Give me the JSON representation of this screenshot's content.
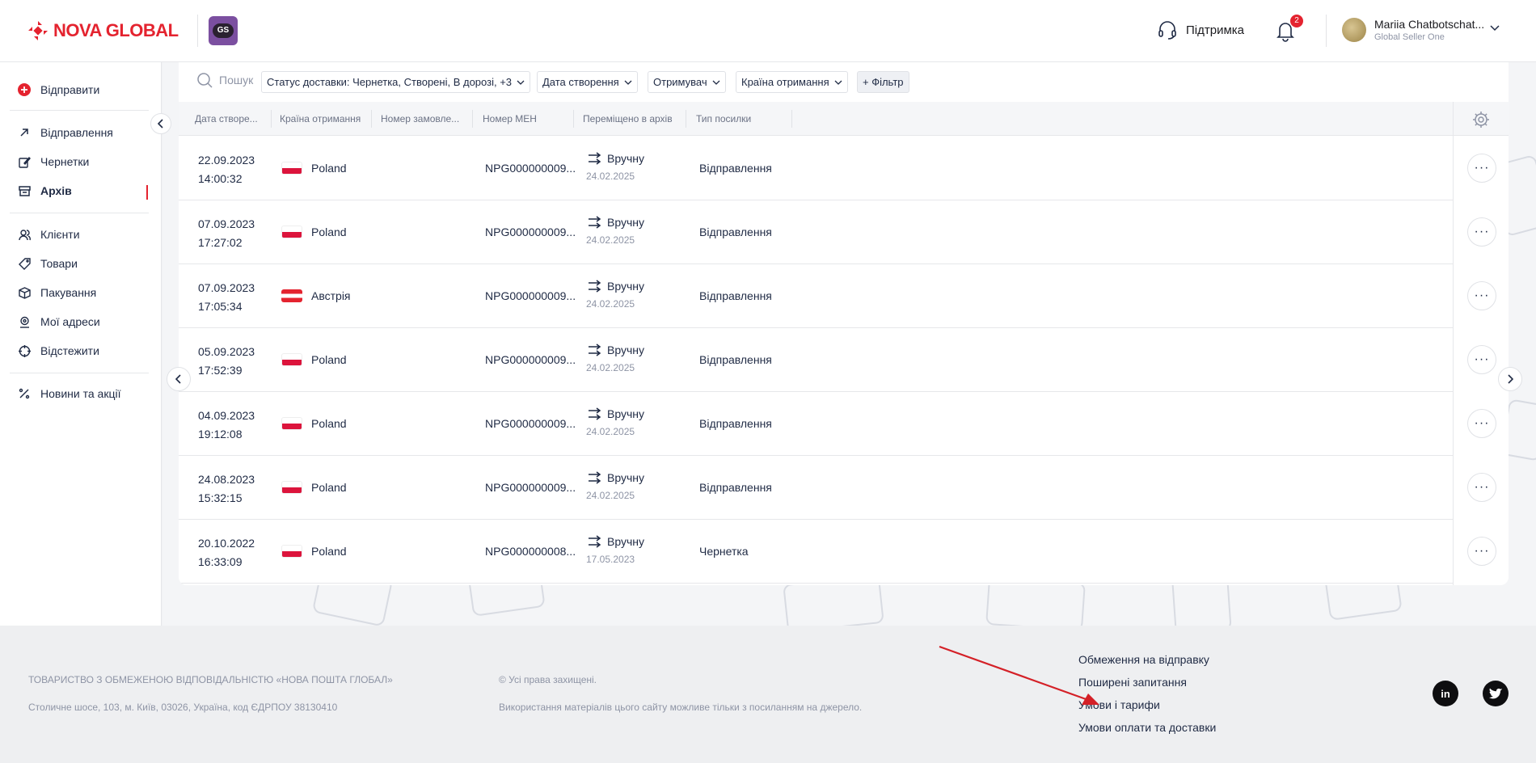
{
  "header": {
    "brand": "NOVA GLOBAL",
    "badge": "GS",
    "support_label": "Підтримка",
    "notifications_count": "2",
    "user_name": "Mariia Chatbotschat...",
    "user_company": "Global Seller One"
  },
  "sidebar": {
    "send_label": "Відправити",
    "items": [
      {
        "label": "Відправлення"
      },
      {
        "label": "Чернетки"
      },
      {
        "label": "Архів"
      },
      {
        "label": "Клієнти"
      },
      {
        "label": "Товари"
      },
      {
        "label": "Пакування"
      },
      {
        "label": "Мої адреси"
      },
      {
        "label": "Відстежити"
      },
      {
        "label": "Новини та акції"
      }
    ]
  },
  "filters": {
    "search_placeholder": "Пошук",
    "status": "Статус доставки: Чернетка, Створені, В дорозі, +3",
    "created": "Дата створення",
    "recipient": "Отримувач",
    "country": "Країна отримання",
    "add_filter": "+ Фільтр"
  },
  "table": {
    "headers": [
      "Дата створе...",
      "Країна отримання",
      "Номер замовле...",
      "Номер МЕН",
      "Переміщено в архів",
      "Тип посилки"
    ],
    "rows": [
      {
        "date": "22.09.2023",
        "time": "14:00:32",
        "country": "Poland",
        "flag": "pl",
        "men": "NPG000000009...",
        "moved": "Вручну",
        "moved_date": "24.02.2025",
        "type": "Відправлення"
      },
      {
        "date": "07.09.2023",
        "time": "17:27:02",
        "country": "Poland",
        "flag": "pl",
        "men": "NPG000000009...",
        "moved": "Вручну",
        "moved_date": "24.02.2025",
        "type": "Відправлення"
      },
      {
        "date": "07.09.2023",
        "time": "17:05:34",
        "country": "Австрія",
        "flag": "at",
        "men": "NPG000000009...",
        "moved": "Вручну",
        "moved_date": "24.02.2025",
        "type": "Відправлення"
      },
      {
        "date": "05.09.2023",
        "time": "17:52:39",
        "country": "Poland",
        "flag": "pl",
        "men": "NPG000000009...",
        "moved": "Вручну",
        "moved_date": "24.02.2025",
        "type": "Відправлення"
      },
      {
        "date": "04.09.2023",
        "time": "19:12:08",
        "country": "Poland",
        "flag": "pl",
        "men": "NPG000000009...",
        "moved": "Вручну",
        "moved_date": "24.02.2025",
        "type": "Відправлення"
      },
      {
        "date": "24.08.2023",
        "time": "15:32:15",
        "country": "Poland",
        "flag": "pl",
        "men": "NPG000000009...",
        "moved": "Вручну",
        "moved_date": "24.02.2025",
        "type": "Відправлення"
      },
      {
        "date": "20.10.2022",
        "time": "16:33:09",
        "country": "Poland",
        "flag": "pl",
        "men": "NPG000000008...",
        "moved": "Вручну",
        "moved_date": "17.05.2023",
        "type": "Чернетка"
      }
    ]
  },
  "footer": {
    "company": "ТОВАРИСТВО З ОБМЕЖЕНОЮ ВІДПОВІДАЛЬНІСТЮ «НОВА ПОШТА ГЛОБАЛ»",
    "address": "Столичне шосе, 103, м. Київ, 03026, Україна, код ЄДРПОУ 38130410",
    "rights": "© Усі права захищені.",
    "usage": "Використання матеріалів цього сайту можливе тільки з посиланням на джерело.",
    "links": [
      "Обмеження на відправку",
      "Поширені запитання",
      "Умови і тарифи",
      "Умови оплати та доставки"
    ],
    "social_in": "in"
  },
  "colors": {
    "brand_red": "#e4232f",
    "badge_purple": "#7b4fa0"
  }
}
